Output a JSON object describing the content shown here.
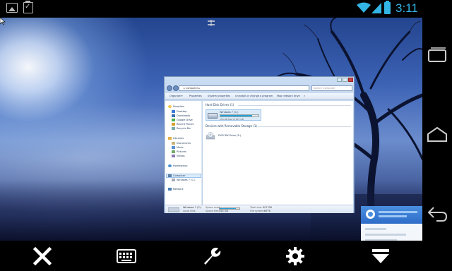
{
  "status_bar": {
    "time": "3:11",
    "icons": [
      "gallery-icon",
      "clipboard-check-icon",
      "wifi-icon",
      "signal-icon",
      "battery-icon"
    ],
    "accent_color": "#33b5e5"
  },
  "explorer": {
    "address": "▸ Computer ▸",
    "search_placeholder": "Search Computer",
    "toolbar": [
      "Organize ▾",
      "Properties",
      "System properties",
      "Uninstall or change a program",
      "Map network drive",
      "»"
    ],
    "nav": {
      "favorites_header": "Favorites",
      "favorites": [
        "Desktop",
        "Downloads",
        "Google Drive",
        "Recent Places",
        "Recycle Bin"
      ],
      "libraries_header": "Libraries",
      "libraries": [
        "Documents",
        "Music",
        "Pictures",
        "Videos"
      ],
      "homegroup": "Homegroup",
      "computer": "Computer",
      "computer_children": [
        "Windows 7 (C:)"
      ],
      "network": "Network"
    },
    "sections": {
      "hard_disks": "Hard Disk Drives (1)",
      "removable": "Devices with Removable Storage (1)"
    },
    "drives": [
      {
        "label": "Windows 7 (C:)",
        "free": "155 GB free of 907 GB",
        "used_fraction": 0.83
      },
      {
        "label": "DVD RW Drive (E:)"
      }
    ],
    "details": {
      "name": "Windows 7 (C:)",
      "type": "Local Disk",
      "space_used_label": "Space used:",
      "space_free_label": "Space free:",
      "space_free": "154 GB",
      "total_size_label": "Total size:",
      "total_size": "907 GB",
      "file_system_label": "File system:",
      "file_system": "NTFS",
      "used_fraction": 0.83
    }
  },
  "bottom_toolbar": [
    "close-icon",
    "keyboard-icon",
    "wrench-icon",
    "gear-icon",
    "menu-down-icon"
  ],
  "android_nav": [
    "recent-apps-icon",
    "home-icon",
    "back-icon"
  ]
}
